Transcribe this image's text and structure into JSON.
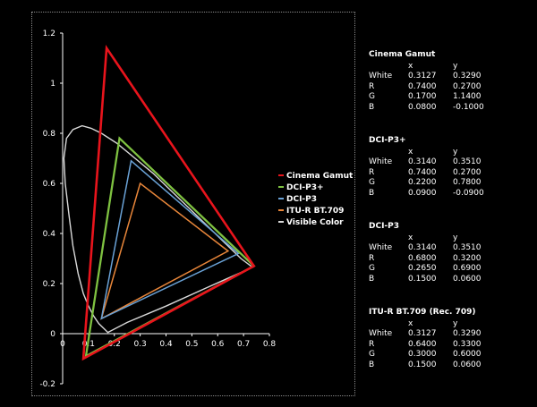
{
  "chart_data": {
    "type": "scatter",
    "xlim": [
      0,
      0.8
    ],
    "ylim": [
      -0.2,
      1.2
    ],
    "x_ticks": [
      "0",
      "0.1",
      "0.2",
      "0.3",
      "0.4",
      "0.5",
      "0.6",
      "0.7",
      "0.8"
    ],
    "y_ticks": [
      "-0.2",
      "0",
      "0.2",
      "0.4",
      "0.6",
      "0.8",
      "1",
      "1.2"
    ],
    "legend_position": "right",
    "series": [
      {
        "name": "Cinema Gamut",
        "color": "#e8141c",
        "points": [
          [
            0.74,
            0.27
          ],
          [
            0.17,
            1.14
          ],
          [
            0.08,
            -0.1
          ]
        ]
      },
      {
        "name": "DCI-P3+",
        "color": "#7fc241",
        "points": [
          [
            0.74,
            0.27
          ],
          [
            0.22,
            0.78
          ],
          [
            0.09,
            -0.09
          ]
        ]
      },
      {
        "name": "DCI-P3",
        "color": "#6aa2d6",
        "points": [
          [
            0.68,
            0.32
          ],
          [
            0.265,
            0.69
          ],
          [
            0.15,
            0.06
          ]
        ]
      },
      {
        "name": "ITU-R BT.709",
        "color": "#e8863a",
        "points": [
          [
            0.64,
            0.33
          ],
          [
            0.3,
            0.6
          ],
          [
            0.15,
            0.06
          ]
        ]
      },
      {
        "name": "Visible Color",
        "color": "#d9d9d9",
        "points": [
          [
            0.175,
            0.005
          ],
          [
            0.16,
            0.02
          ],
          [
            0.14,
            0.04
          ],
          [
            0.12,
            0.07
          ],
          [
            0.1,
            0.11
          ],
          [
            0.08,
            0.16
          ],
          [
            0.06,
            0.24
          ],
          [
            0.04,
            0.35
          ],
          [
            0.025,
            0.47
          ],
          [
            0.01,
            0.6
          ],
          [
            0.005,
            0.7
          ],
          [
            0.015,
            0.78
          ],
          [
            0.04,
            0.815
          ],
          [
            0.075,
            0.83
          ],
          [
            0.11,
            0.82
          ],
          [
            0.15,
            0.8
          ],
          [
            0.21,
            0.76
          ],
          [
            0.28,
            0.7
          ],
          [
            0.35,
            0.64
          ],
          [
            0.42,
            0.57
          ],
          [
            0.5,
            0.49
          ],
          [
            0.57,
            0.42
          ],
          [
            0.63,
            0.36
          ],
          [
            0.69,
            0.3
          ],
          [
            0.735,
            0.265
          ],
          [
            0.55,
            0.18
          ],
          [
            0.4,
            0.11
          ],
          [
            0.25,
            0.045
          ],
          [
            0.175,
            0.005
          ]
        ]
      }
    ]
  },
  "tables": [
    {
      "title": "Cinema Gamut",
      "header": [
        "",
        "x",
        "y"
      ],
      "rows": [
        [
          "White",
          "0.3127",
          "0.3290"
        ],
        [
          "R",
          "0.7400",
          "0.2700"
        ],
        [
          "G",
          "0.1700",
          "1.1400"
        ],
        [
          "B",
          "0.0800",
          "-0.1000"
        ]
      ]
    },
    {
      "title": "DCI-P3+",
      "header": [
        "",
        "x",
        "y"
      ],
      "rows": [
        [
          "White",
          "0.3140",
          "0.3510"
        ],
        [
          "R",
          "0.7400",
          "0.2700"
        ],
        [
          "G",
          "0.2200",
          "0.7800"
        ],
        [
          "B",
          "0.0900",
          "-0.0900"
        ]
      ]
    },
    {
      "title": "DCI-P3",
      "header": [
        "",
        "x",
        "y"
      ],
      "rows": [
        [
          "White",
          "0.3140",
          "0.3510"
        ],
        [
          "R",
          "0.6800",
          "0.3200"
        ],
        [
          "G",
          "0.2650",
          "0.6900"
        ],
        [
          "B",
          "0.1500",
          "0.0600"
        ]
      ]
    },
    {
      "title": "ITU-R BT.709 (Rec. 709)",
      "header": [
        "",
        "x",
        "y"
      ],
      "rows": [
        [
          "White",
          "0.3127",
          "0.3290"
        ],
        [
          "R",
          "0.6400",
          "0.3300"
        ],
        [
          "G",
          "0.3000",
          "0.6000"
        ],
        [
          "B",
          "0.1500",
          "0.0600"
        ]
      ]
    }
  ]
}
